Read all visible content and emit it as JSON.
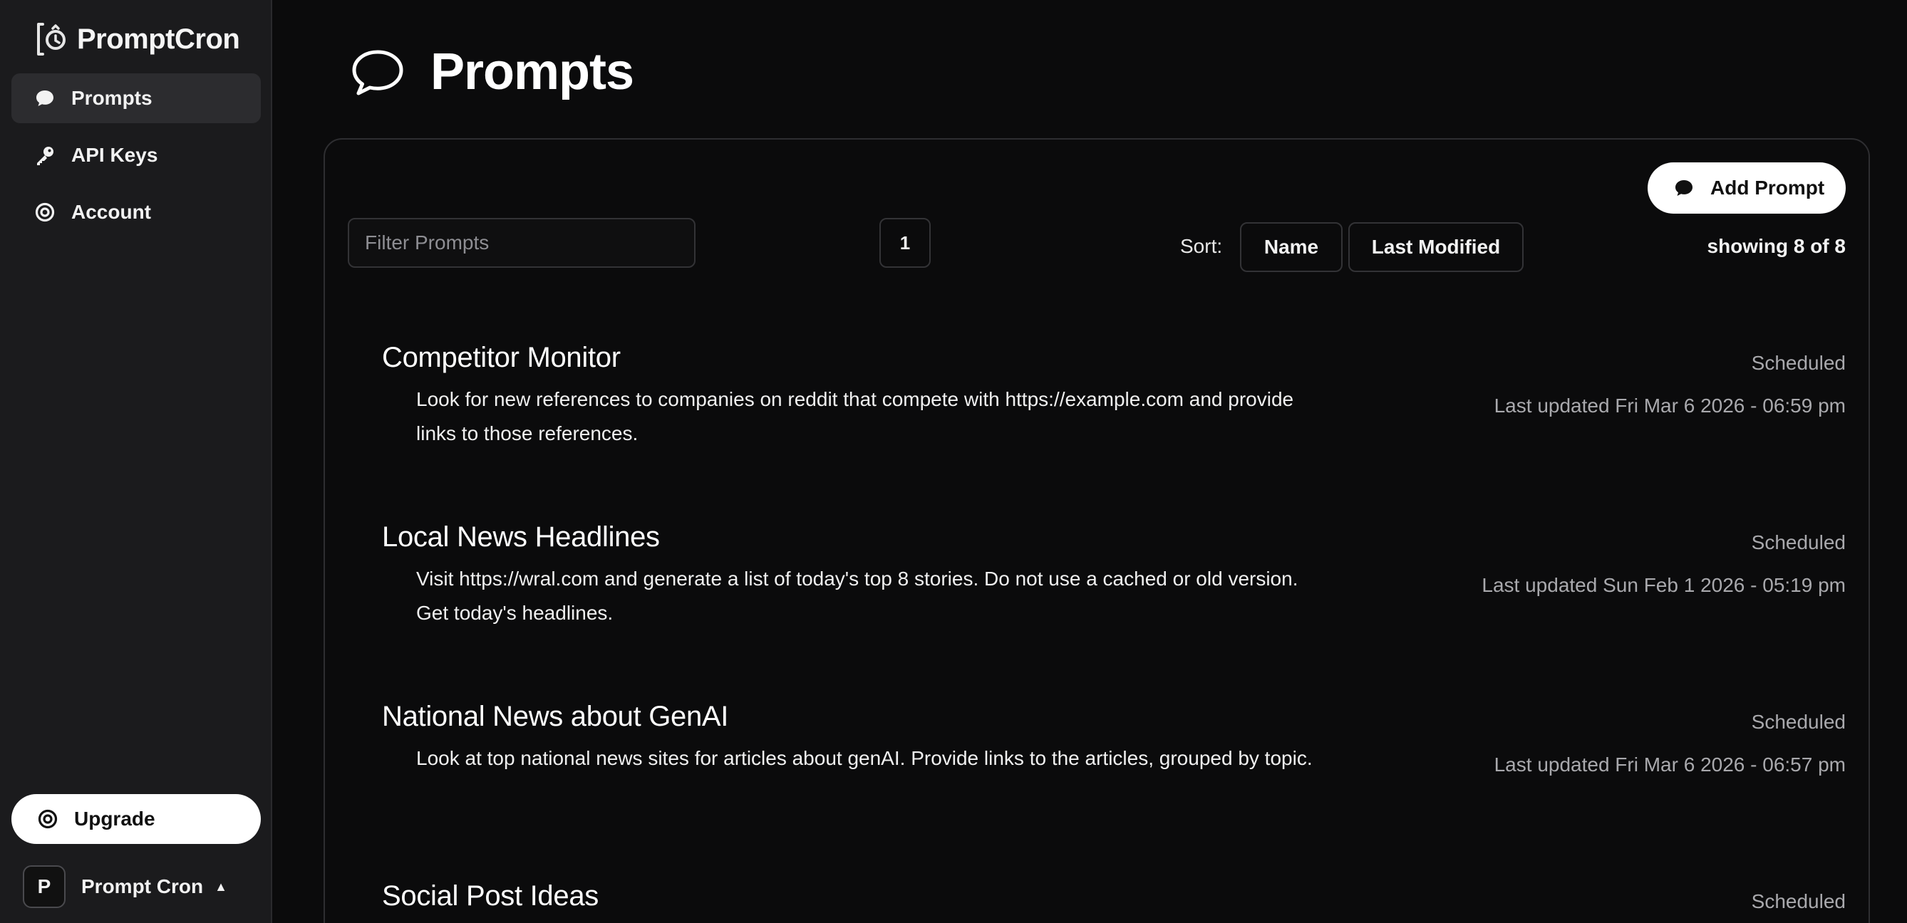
{
  "brand": {
    "name": "PromptCron"
  },
  "sidebar": {
    "items": [
      {
        "label": "Prompts",
        "icon": "chat-bubble-icon",
        "active": true
      },
      {
        "label": "API Keys",
        "icon": "key-icon",
        "active": false
      },
      {
        "label": "Account",
        "icon": "target-icon",
        "active": false
      }
    ],
    "upgrade_label": "Upgrade",
    "user": {
      "initial": "P",
      "name": "Prompt Cron"
    }
  },
  "page": {
    "title": "Prompts"
  },
  "toolbar": {
    "add_label": "Add Prompt",
    "filter_placeholder": "Filter Prompts",
    "page_number": "1",
    "sort_label": "Sort:",
    "sort_name": "Name",
    "sort_modified": "Last Modified",
    "showing": "showing 8 of 8"
  },
  "prompts": [
    {
      "title": "Competitor Monitor",
      "description": "Look for new references to companies on reddit that compete with https://example.com and provide links to those references.",
      "status": "Scheduled",
      "updated": "Last updated Fri Mar 6 2026 - 06:59 pm"
    },
    {
      "title": "Local News Headlines",
      "description": "Visit https://wral.com and generate a list of today's top 8 stories. Do not use a cached or old version. Get today's headlines.",
      "status": "Scheduled",
      "updated": "Last updated Sun Feb 1 2026 - 05:19 pm"
    },
    {
      "title": "National News about GenAI",
      "description": "Look at top national news sites for articles about genAI. Provide links to the articles, grouped by topic.",
      "status": "Scheduled",
      "updated": "Last updated Fri Mar 6 2026 - 06:57 pm"
    },
    {
      "title": "Social Post Ideas",
      "description": "",
      "status": "Scheduled",
      "updated": ""
    }
  ]
}
